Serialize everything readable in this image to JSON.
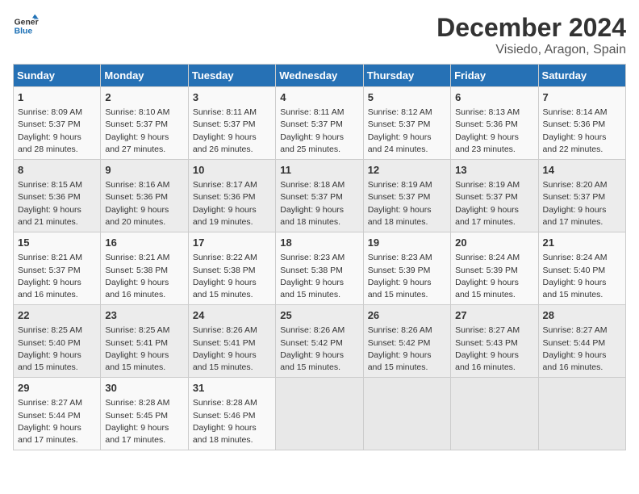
{
  "logo": {
    "line1": "General",
    "line2": "Blue"
  },
  "title": "December 2024",
  "location": "Visiedo, Aragon, Spain",
  "days_of_week": [
    "Sunday",
    "Monday",
    "Tuesday",
    "Wednesday",
    "Thursday",
    "Friday",
    "Saturday"
  ],
  "weeks": [
    [
      {
        "day": "1",
        "sunrise": "Sunrise: 8:09 AM",
        "sunset": "Sunset: 5:37 PM",
        "daylight": "Daylight: 9 hours and 28 minutes."
      },
      {
        "day": "2",
        "sunrise": "Sunrise: 8:10 AM",
        "sunset": "Sunset: 5:37 PM",
        "daylight": "Daylight: 9 hours and 27 minutes."
      },
      {
        "day": "3",
        "sunrise": "Sunrise: 8:11 AM",
        "sunset": "Sunset: 5:37 PM",
        "daylight": "Daylight: 9 hours and 26 minutes."
      },
      {
        "day": "4",
        "sunrise": "Sunrise: 8:11 AM",
        "sunset": "Sunset: 5:37 PM",
        "daylight": "Daylight: 9 hours and 25 minutes."
      },
      {
        "day": "5",
        "sunrise": "Sunrise: 8:12 AM",
        "sunset": "Sunset: 5:37 PM",
        "daylight": "Daylight: 9 hours and 24 minutes."
      },
      {
        "day": "6",
        "sunrise": "Sunrise: 8:13 AM",
        "sunset": "Sunset: 5:36 PM",
        "daylight": "Daylight: 9 hours and 23 minutes."
      },
      {
        "day": "7",
        "sunrise": "Sunrise: 8:14 AM",
        "sunset": "Sunset: 5:36 PM",
        "daylight": "Daylight: 9 hours and 22 minutes."
      }
    ],
    [
      {
        "day": "8",
        "sunrise": "Sunrise: 8:15 AM",
        "sunset": "Sunset: 5:36 PM",
        "daylight": "Daylight: 9 hours and 21 minutes."
      },
      {
        "day": "9",
        "sunrise": "Sunrise: 8:16 AM",
        "sunset": "Sunset: 5:36 PM",
        "daylight": "Daylight: 9 hours and 20 minutes."
      },
      {
        "day": "10",
        "sunrise": "Sunrise: 8:17 AM",
        "sunset": "Sunset: 5:36 PM",
        "daylight": "Daylight: 9 hours and 19 minutes."
      },
      {
        "day": "11",
        "sunrise": "Sunrise: 8:18 AM",
        "sunset": "Sunset: 5:37 PM",
        "daylight": "Daylight: 9 hours and 18 minutes."
      },
      {
        "day": "12",
        "sunrise": "Sunrise: 8:19 AM",
        "sunset": "Sunset: 5:37 PM",
        "daylight": "Daylight: 9 hours and 18 minutes."
      },
      {
        "day": "13",
        "sunrise": "Sunrise: 8:19 AM",
        "sunset": "Sunset: 5:37 PM",
        "daylight": "Daylight: 9 hours and 17 minutes."
      },
      {
        "day": "14",
        "sunrise": "Sunrise: 8:20 AM",
        "sunset": "Sunset: 5:37 PM",
        "daylight": "Daylight: 9 hours and 17 minutes."
      }
    ],
    [
      {
        "day": "15",
        "sunrise": "Sunrise: 8:21 AM",
        "sunset": "Sunset: 5:37 PM",
        "daylight": "Daylight: 9 hours and 16 minutes."
      },
      {
        "day": "16",
        "sunrise": "Sunrise: 8:21 AM",
        "sunset": "Sunset: 5:38 PM",
        "daylight": "Daylight: 9 hours and 16 minutes."
      },
      {
        "day": "17",
        "sunrise": "Sunrise: 8:22 AM",
        "sunset": "Sunset: 5:38 PM",
        "daylight": "Daylight: 9 hours and 15 minutes."
      },
      {
        "day": "18",
        "sunrise": "Sunrise: 8:23 AM",
        "sunset": "Sunset: 5:38 PM",
        "daylight": "Daylight: 9 hours and 15 minutes."
      },
      {
        "day": "19",
        "sunrise": "Sunrise: 8:23 AM",
        "sunset": "Sunset: 5:39 PM",
        "daylight": "Daylight: 9 hours and 15 minutes."
      },
      {
        "day": "20",
        "sunrise": "Sunrise: 8:24 AM",
        "sunset": "Sunset: 5:39 PM",
        "daylight": "Daylight: 9 hours and 15 minutes."
      },
      {
        "day": "21",
        "sunrise": "Sunrise: 8:24 AM",
        "sunset": "Sunset: 5:40 PM",
        "daylight": "Daylight: 9 hours and 15 minutes."
      }
    ],
    [
      {
        "day": "22",
        "sunrise": "Sunrise: 8:25 AM",
        "sunset": "Sunset: 5:40 PM",
        "daylight": "Daylight: 9 hours and 15 minutes."
      },
      {
        "day": "23",
        "sunrise": "Sunrise: 8:25 AM",
        "sunset": "Sunset: 5:41 PM",
        "daylight": "Daylight: 9 hours and 15 minutes."
      },
      {
        "day": "24",
        "sunrise": "Sunrise: 8:26 AM",
        "sunset": "Sunset: 5:41 PM",
        "daylight": "Daylight: 9 hours and 15 minutes."
      },
      {
        "day": "25",
        "sunrise": "Sunrise: 8:26 AM",
        "sunset": "Sunset: 5:42 PM",
        "daylight": "Daylight: 9 hours and 15 minutes."
      },
      {
        "day": "26",
        "sunrise": "Sunrise: 8:26 AM",
        "sunset": "Sunset: 5:42 PM",
        "daylight": "Daylight: 9 hours and 15 minutes."
      },
      {
        "day": "27",
        "sunrise": "Sunrise: 8:27 AM",
        "sunset": "Sunset: 5:43 PM",
        "daylight": "Daylight: 9 hours and 16 minutes."
      },
      {
        "day": "28",
        "sunrise": "Sunrise: 8:27 AM",
        "sunset": "Sunset: 5:44 PM",
        "daylight": "Daylight: 9 hours and 16 minutes."
      }
    ],
    [
      {
        "day": "29",
        "sunrise": "Sunrise: 8:27 AM",
        "sunset": "Sunset: 5:44 PM",
        "daylight": "Daylight: 9 hours and 17 minutes."
      },
      {
        "day": "30",
        "sunrise": "Sunrise: 8:28 AM",
        "sunset": "Sunset: 5:45 PM",
        "daylight": "Daylight: 9 hours and 17 minutes."
      },
      {
        "day": "31",
        "sunrise": "Sunrise: 8:28 AM",
        "sunset": "Sunset: 5:46 PM",
        "daylight": "Daylight: 9 hours and 18 minutes."
      },
      null,
      null,
      null,
      null
    ]
  ]
}
